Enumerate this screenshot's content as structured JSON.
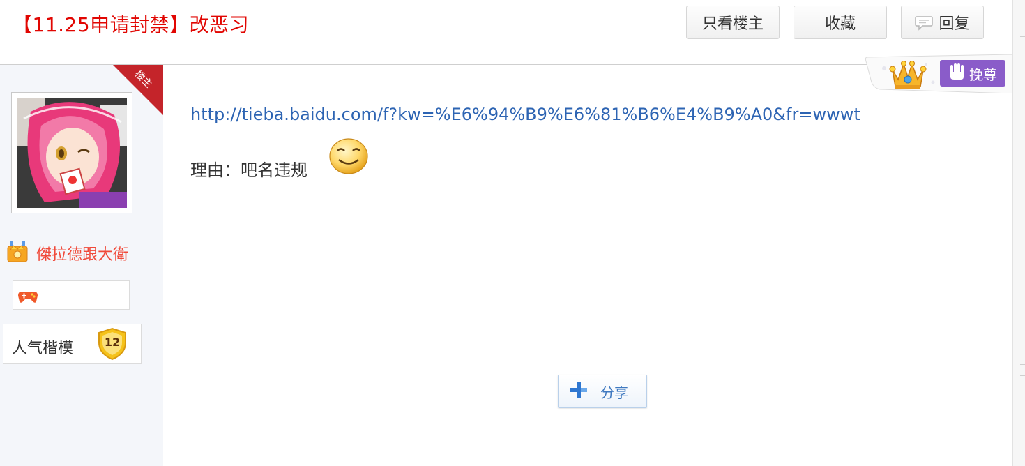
{
  "thread": {
    "title": "【11.25申请封禁】改恶习"
  },
  "toolbar": {
    "only_author_label": "只看楼主",
    "favorite_label": "收藏",
    "reply_label": "回复"
  },
  "author": {
    "corner_badge": "楼主",
    "username": "傑拉德跟大衛",
    "level_title": "人气楷模",
    "level_number": "12"
  },
  "post": {
    "link_text": "http://tieba.baidu.com/f?kw=%E6%94%B9%E6%81%B6%E4%B9%A0&fr=wwwt",
    "reason_text": "理由：吧名违规"
  },
  "badges": {
    "wanzun_label": "挽尊"
  },
  "share": {
    "label": "分享"
  },
  "icons": {
    "reply": "speech-bubble-icon",
    "crown": "crown-icon",
    "wanzun": "fist-icon",
    "smiley": "smiley-emoticon-icon",
    "share": "plus-icon",
    "vip": "crown-vip-icon",
    "game": "gamepad-icon",
    "level": "shield-badge-icon"
  },
  "colors": {
    "title": "#e10602",
    "link": "#2d64b3",
    "username": "#f04a3a",
    "corner": "#c4242a",
    "wanzun_bg": "#8a5cc9"
  }
}
